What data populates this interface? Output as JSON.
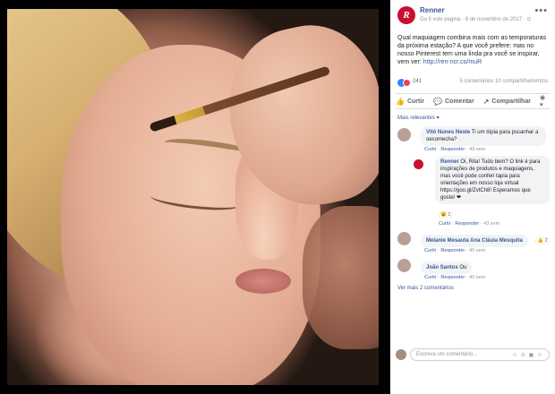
{
  "post": {
    "page_name": "Renner",
    "logo_letter": "R",
    "meta": "Ou ti vote pagina · 8 de novembro de 2017 · ⊙",
    "text_before_link": "Qual maquiagem combina mais com as temporaturas da próxima estação? A que você prefere: mas no nosso Pinterest tem uma linda pra você se inspirar, vem ver:",
    "link": "http://ren-ncr.co/muR"
  },
  "reactions": {
    "count": "241",
    "comments_shares": "5 comentários  10 compartilhamentos"
  },
  "actions": {
    "like": "Curtir",
    "comment": "Comentar",
    "share": "Compartilhar",
    "sort": "Mais relevantes ▾"
  },
  "comments": [
    {
      "author": "Vitó Nunes Neste",
      "text": "Ti um tópia para pscanhar a oecomecha?",
      "like": "Curtir",
      "reply": "Responder",
      "time": "49 sem"
    },
    {
      "author": "Renner",
      "text": "Oi, Rita! Tudo bem? O link é para inspirações de produtos e maquiagens, mas você pode conferi tapia para orientações em nosso loja virtual https://goo.gl/ZvtCh8! Esperamos que goste! ❤",
      "reaction": "😮 1",
      "like": "Curtir",
      "reply": "Responder",
      "time": "43 sem"
    },
    {
      "author": "Melanie Mesauta Ana Cláuia Mesquita",
      "reaction": "👍 2",
      "like": "Curtir",
      "reply": "Responder",
      "time": "40 sem"
    },
    {
      "author": "João Santos",
      "text": "Ou",
      "like": "Curtir",
      "reply": "Responder",
      "time": "40 sem"
    }
  ],
  "more_comments": "Ver mais 2 comentários",
  "composer": {
    "placeholder": "Escreva um comentário...",
    "emojis": "☺ ⊙ ▣ ☺"
  }
}
